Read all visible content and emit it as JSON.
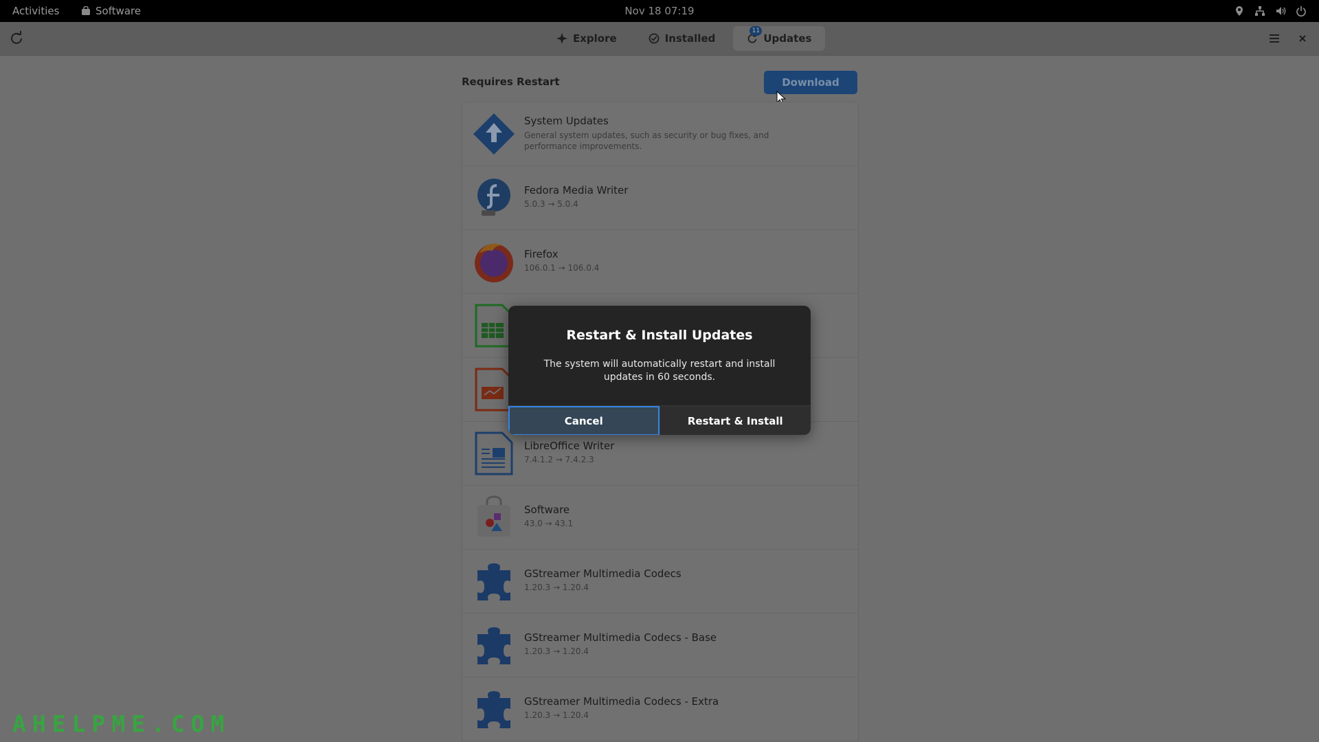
{
  "topbar": {
    "activities": "Activities",
    "app_menu": "Software",
    "clock": "Nov 18  07:19"
  },
  "headerbar": {
    "tabs": [
      {
        "label": "Explore",
        "icon": "explore-icon"
      },
      {
        "label": "Installed",
        "icon": "installed-icon"
      },
      {
        "label": "Updates",
        "icon": "updates-icon",
        "badge": "11",
        "active": true
      }
    ]
  },
  "main": {
    "section_title": "Requires Restart",
    "download_label": "Download",
    "updates": [
      {
        "name": "System Updates",
        "description": "General system updates, such as security or bug fixes, and performance improvements.",
        "icon": "system-updates-icon"
      },
      {
        "name": "Fedora Media Writer",
        "version": "5.0.3 → 5.0.4",
        "icon": "fedora-media-writer-icon"
      },
      {
        "name": "Firefox",
        "version": "106.0.1 → 106.0.4",
        "icon": "firefox-icon"
      },
      {
        "name": "",
        "version": "",
        "icon": "libreoffice-calc-icon"
      },
      {
        "name": "",
        "version": "",
        "icon": "libreoffice-impress-icon"
      },
      {
        "name": "LibreOffice Writer",
        "version": "7.4.1.2 → 7.4.2.3",
        "icon": "libreoffice-writer-icon"
      },
      {
        "name": "Software",
        "version": "43.0 → 43.1",
        "icon": "software-icon"
      },
      {
        "name": "GStreamer Multimedia Codecs",
        "version": "1.20.3 → 1.20.4",
        "icon": "puzzle-icon"
      },
      {
        "name": "GStreamer Multimedia Codecs - Base",
        "version": "1.20.3 → 1.20.4",
        "icon": "puzzle-icon"
      },
      {
        "name": "GStreamer Multimedia Codecs - Extra",
        "version": "1.20.3 → 1.20.4",
        "icon": "puzzle-icon"
      }
    ]
  },
  "dialog": {
    "title": "Restart & Install Updates",
    "body": "The system will automatically restart and install updates in 60 seconds.",
    "cancel_label": "Cancel",
    "confirm_label": "Restart & Install"
  },
  "watermark": "AHELPME.COM",
  "colors": {
    "accent": "#3584e4",
    "dialog_bg": "#242424",
    "download_bg": "#1c4576"
  }
}
